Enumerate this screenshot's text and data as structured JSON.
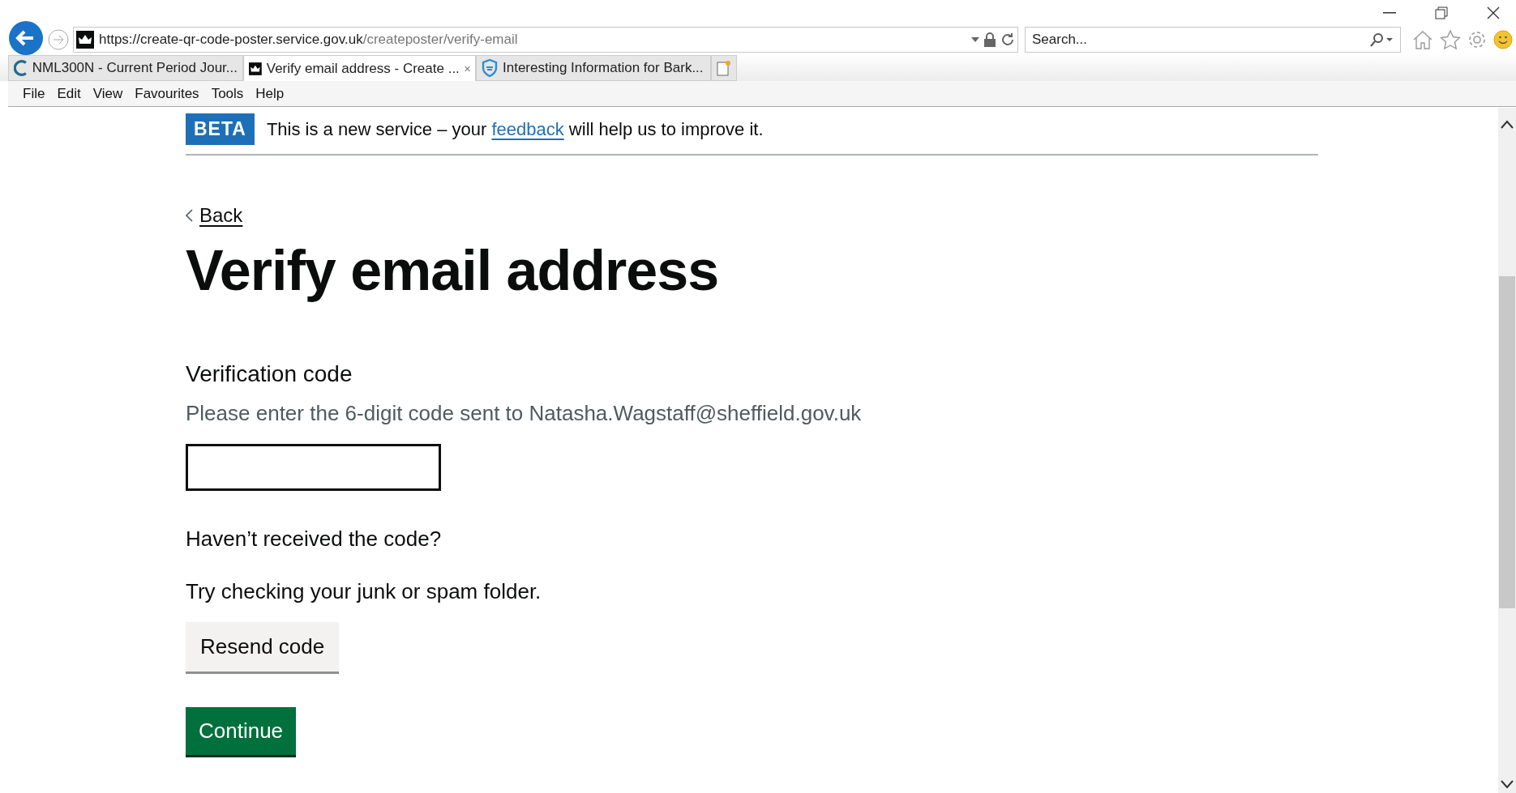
{
  "browser": {
    "address": {
      "host": "https://create-qr-code-poster.service.gov.uk",
      "path": "/createposter/verify-email"
    },
    "search": {
      "placeholder": "Search..."
    },
    "tabs": [
      {
        "label": "NML300N - Current Period Jour...",
        "kind": "letter",
        "selected": false
      },
      {
        "label": "Verify email address - Create ...",
        "kind": "crown",
        "selected": true
      },
      {
        "label": "Interesting Information for Bark...",
        "kind": "shield",
        "selected": false
      }
    ],
    "menu": [
      "File",
      "Edit",
      "View",
      "Favourites",
      "Tools",
      "Help"
    ]
  },
  "phase_banner": {
    "tag": "BETA",
    "text_before": "This is a new service – your",
    "link": "feedback",
    "text_after": "will help us to improve it."
  },
  "back_link": "Back",
  "heading": "Verify email address",
  "field": {
    "label": "Verification code",
    "hint": "Please enter the 6-digit code sent to Natasha.Wagstaff@sheffield.gov.uk"
  },
  "help_title": "Haven’t received the code?",
  "help_text": "Try checking your junk or spam folder.",
  "buttons": [
    {
      "label": "Resend code",
      "kind": "secondary"
    },
    {
      "label": "Continue",
      "kind": "primary"
    }
  ]
}
